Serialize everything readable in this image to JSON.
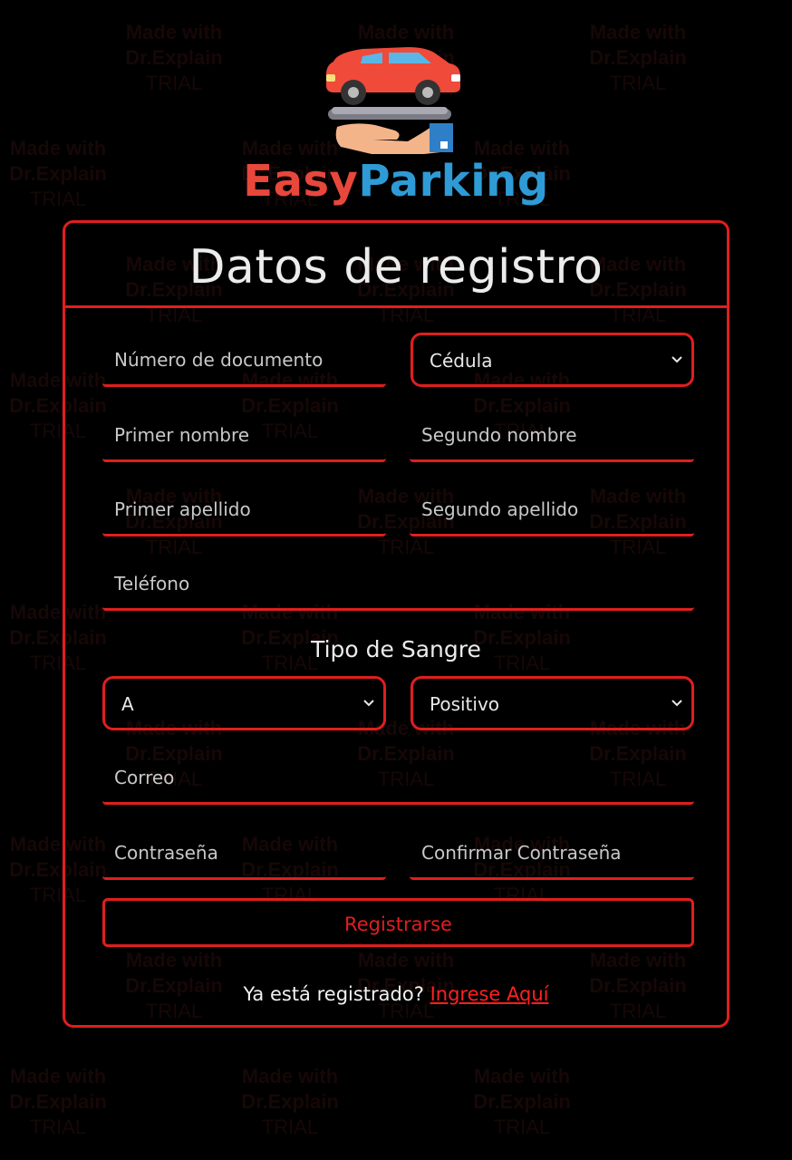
{
  "brand": {
    "name_part1": "Easy",
    "name_part2": "Parking",
    "color_part1": "#e8473c",
    "color_part2": "#2e9bd6",
    "logo_icon": "car-on-hand-icon"
  },
  "form": {
    "title": "Datos de registro",
    "document_number_placeholder": "Número de documento",
    "document_type": {
      "selected": "Cédula"
    },
    "first_name_placeholder": "Primer nombre",
    "second_name_placeholder": "Segundo nombre",
    "first_lastname_placeholder": "Primer apellido",
    "second_lastname_placeholder": "Segundo apellido",
    "phone_placeholder": "Teléfono",
    "blood_type_label": "Tipo de Sangre",
    "blood_group": {
      "selected": "A"
    },
    "blood_rh": {
      "selected": "Positivo"
    },
    "email_placeholder": "Correo",
    "password_placeholder": "Contraseña",
    "confirm_password_placeholder": "Confirmar Contraseña",
    "submit_label": "Registrarse",
    "login_prompt": "Ya está registrado?",
    "login_link": "Ingrese Aquí"
  },
  "watermark": {
    "line1": "Made with",
    "line2": "Dr.Explain",
    "line3": "TRIAL"
  },
  "colors": {
    "accent": "#e01e1e",
    "background": "#000000",
    "text": "#ececec"
  }
}
